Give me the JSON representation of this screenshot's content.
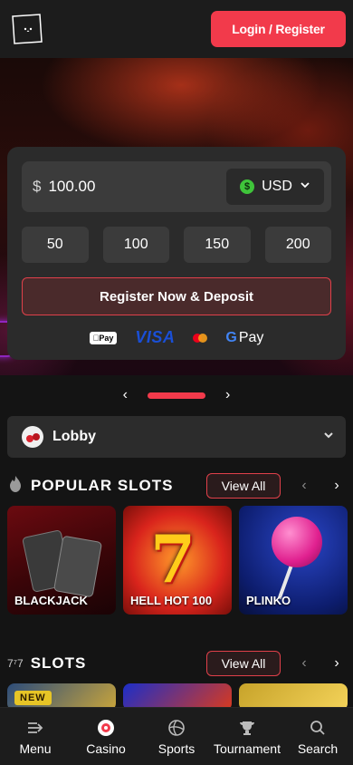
{
  "header": {
    "logo_icon": "box-logo-icon",
    "login_label": "Login / Register"
  },
  "deposit": {
    "currency_symbol": "$",
    "amount": "100.00",
    "currency_label": "USD",
    "currency_coin_glyph": "$",
    "quick_amounts": [
      "50",
      "100",
      "150",
      "200"
    ],
    "register_label": "Register Now & Deposit",
    "payments": {
      "apple_pay": "Pay",
      "visa": "VISA",
      "gpay": "Pay",
      "gpay_g": "G"
    }
  },
  "lobby": {
    "label": "Lobby"
  },
  "popular_slots": {
    "title": "POPULAR SLOTS",
    "view_all": "View All",
    "games": [
      {
        "title": "BLACKJACK"
      },
      {
        "title": "HELL HOT 100"
      },
      {
        "title": "PLINKO"
      }
    ]
  },
  "slots": {
    "title": "SLOTS",
    "title_icon_text": "7⁷7",
    "view_all": "View All",
    "new_badge": "NEW"
  },
  "bottom_nav": {
    "items": [
      {
        "label": "Menu",
        "icon": "menu-arrow-icon"
      },
      {
        "label": "Casino",
        "icon": "casino-icon"
      },
      {
        "label": "Sports",
        "icon": "volleyball-icon"
      },
      {
        "label": "Tournament",
        "icon": "trophy-icon"
      },
      {
        "label": "Search",
        "icon": "search-icon"
      }
    ],
    "active": "Casino"
  },
  "colors": {
    "accent": "#f23a4b",
    "background": "#141414",
    "card": "#2b2b2b"
  }
}
